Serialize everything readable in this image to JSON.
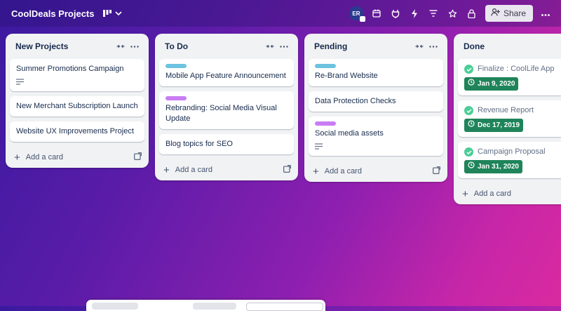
{
  "board": {
    "title": "CoolDeals Projects"
  },
  "topbar": {
    "avatar_initials": "ER",
    "share_label": "Share",
    "icons": [
      "calendar-icon",
      "power-ups-icon",
      "automation-icon",
      "filter-icon",
      "star-icon",
      "lock-icon"
    ]
  },
  "lists": [
    {
      "title": "New Projects",
      "cards": [
        {
          "title": "Summer Promotions Campaign",
          "has_description": true
        },
        {
          "title": "New Merchant Subscription Launch"
        },
        {
          "title": "Website UX Improvements Project"
        }
      ],
      "add_label": "Add a card"
    },
    {
      "title": "To Do",
      "cards": [
        {
          "title": "Mobile App Feature Announcement",
          "label_color": "#6cc3e0"
        },
        {
          "title": "Rebranding: Social Media Visual Update",
          "label_color": "#c97cf4"
        },
        {
          "title": "Blog topics for SEO"
        }
      ],
      "add_label": "Add a card"
    },
    {
      "title": "Pending",
      "cards": [
        {
          "title": "Re-Brand Website",
          "label_color": "#6cc3e0"
        },
        {
          "title": "Data Protection Checks"
        },
        {
          "title": "Social media assets",
          "label_color": "#c97cf4",
          "has_description": true
        }
      ],
      "add_label": "Add a card"
    },
    {
      "title": "Done",
      "cards": [
        {
          "title": "Finalize : CoolLife App De",
          "due": "Jan 9, 2020"
        },
        {
          "title": "Revenue Report",
          "due": "Dec 17, 2019"
        },
        {
          "title": "Campaign Proposal",
          "due": "Jan 31, 2020"
        }
      ],
      "add_label": "Add a card"
    }
  ]
}
